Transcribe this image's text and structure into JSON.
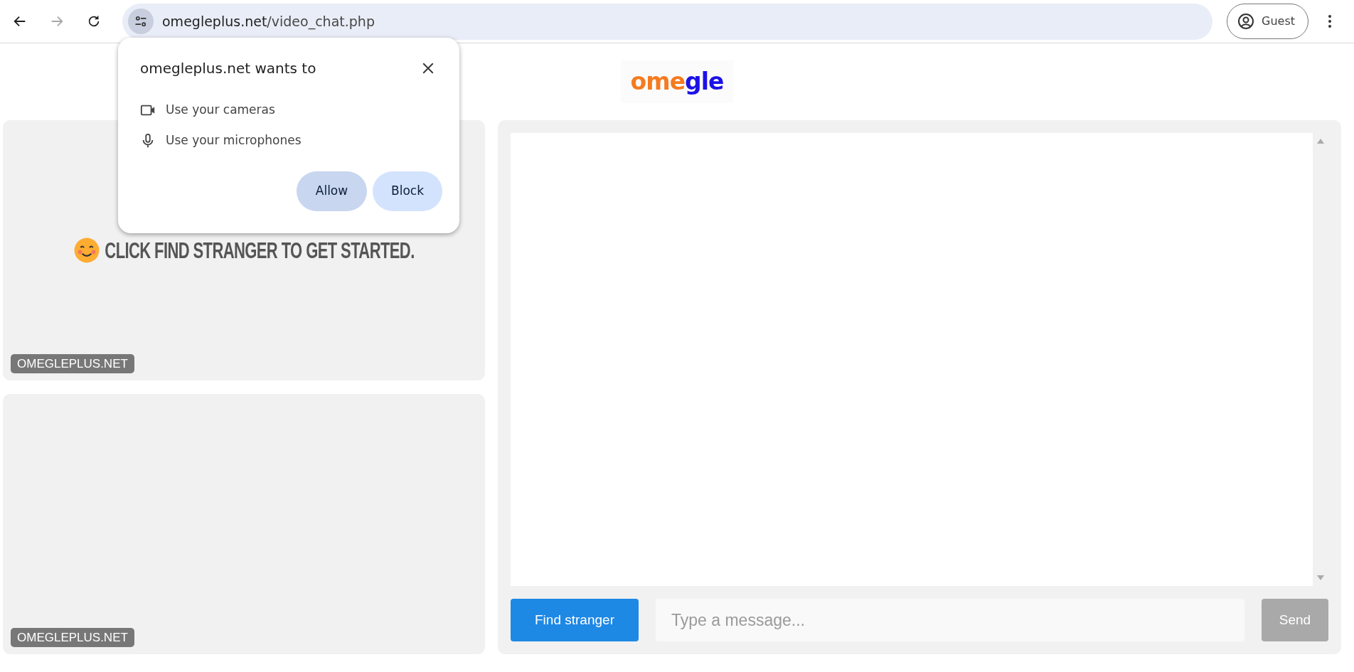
{
  "browser": {
    "nav_buttons": [
      {
        "kind": "back",
        "disabled": false
      },
      {
        "kind": "forward",
        "disabled": true
      },
      {
        "kind": "reload",
        "disabled": false
      }
    ],
    "url_host": "omegleplus.net",
    "url_path": "/video_chat.php",
    "profile": "Guest"
  },
  "permission_popup": {
    "title": "omegleplus.net wants to",
    "permissions": [
      {
        "kind": "camera",
        "label": "Use your cameras"
      },
      {
        "kind": "microphone",
        "label": "Use your microphones"
      }
    ],
    "buttons": [
      {
        "label": "Allow",
        "focused": true
      },
      {
        "label": "Block",
        "focused": false
      }
    ]
  },
  "logo": {
    "parts": [
      {
        "text": "ome",
        "color": "#f47b20"
      },
      {
        "text": "gle",
        "color": "#1c12e6"
      }
    ]
  },
  "video_panels": [
    {
      "message": "CLICK FIND STRANGER TO GET STARTED.",
      "watermark": "OMEGLEPLUS.NET"
    },
    {
      "watermark": "OMEGLEPLUS.NET"
    }
  ],
  "chat": {
    "find_button": "Find stranger",
    "placeholder": "Type a message...",
    "send_button": {
      "label": "Send",
      "disabled": true
    }
  }
}
